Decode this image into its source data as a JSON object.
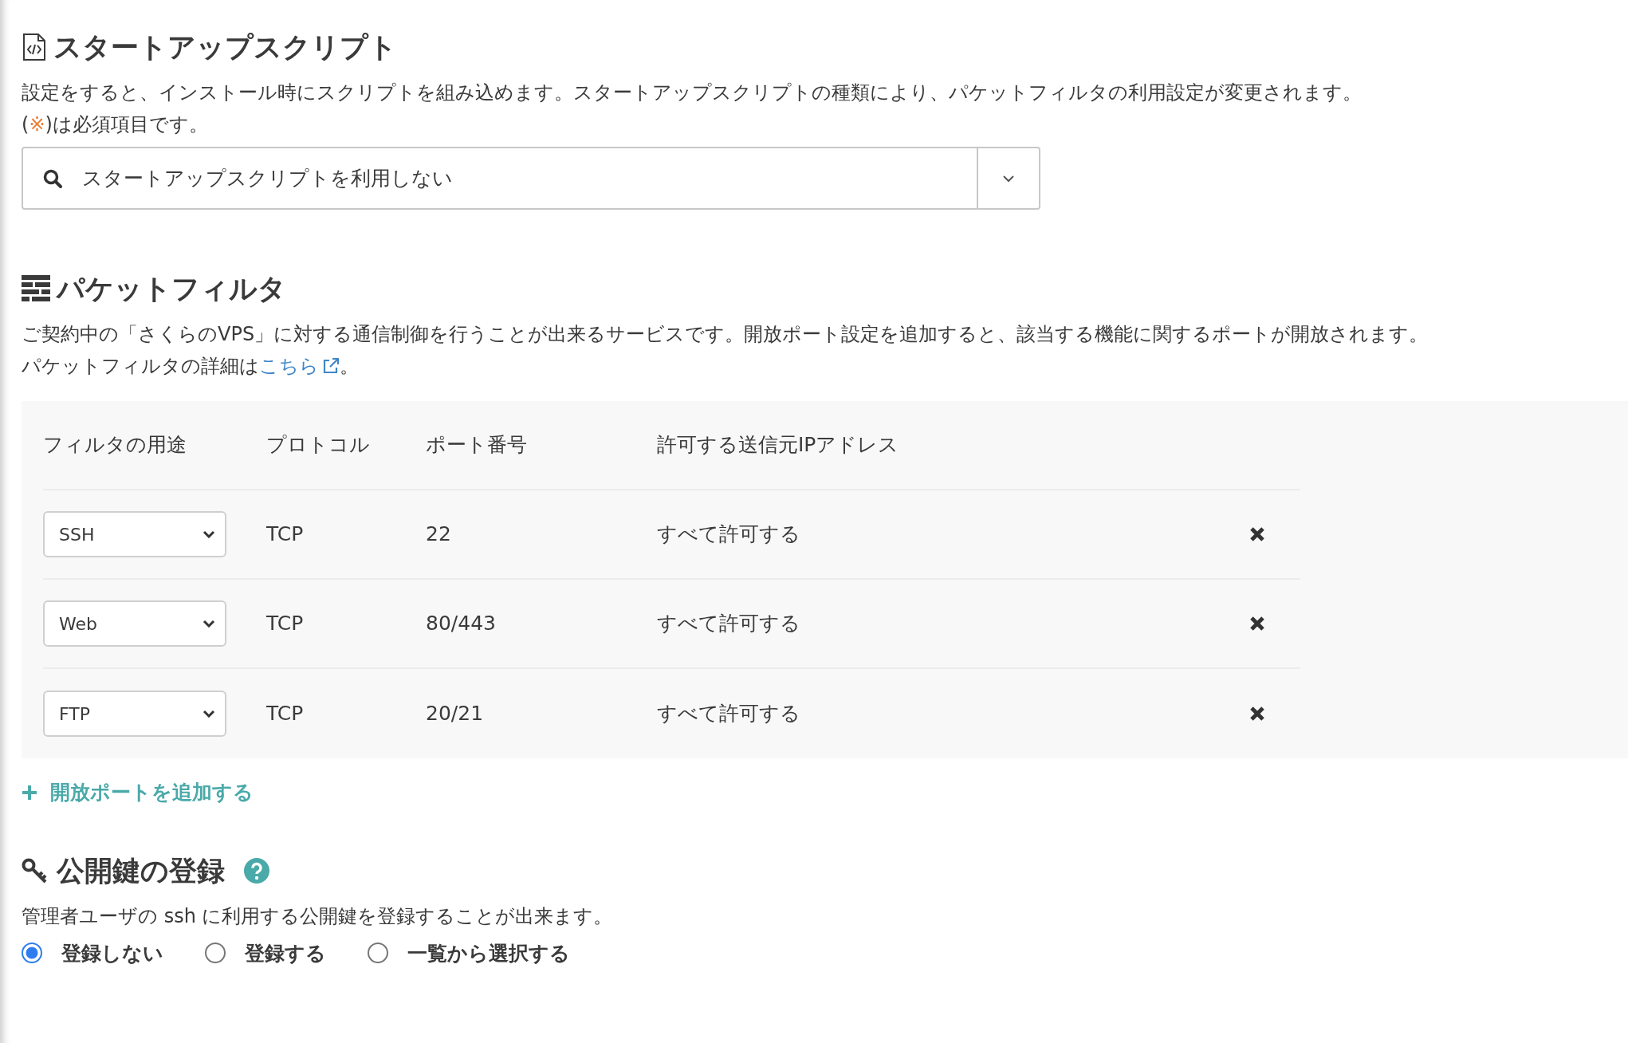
{
  "startup_script": {
    "title": "スタートアップスクリプト",
    "description": "設定をすると、インストール時にスクリプトを組み込めます。スタートアップスクリプトの種類により、パケットフィルタの利用設定が変更されます。",
    "required_note_prefix": "(",
    "required_mark": "※",
    "required_note_suffix": ")は必須項目です。",
    "select_value": "スタートアップスクリプトを利用しない"
  },
  "packet_filter": {
    "title": "パケットフィルタ",
    "description": "ご契約中の「さくらのVPS」に対する通信制御を行うことが出来るサービスです。開放ポート設定を追加すると、該当する機能に関するポートが開放されます。",
    "detail_prefix": "パケットフィルタの詳細は",
    "detail_link": "こちら",
    "detail_suffix": "。",
    "columns": [
      "フィルタの用途",
      "プロトコル",
      "ポート番号",
      "許可する送信元IPアドレス"
    ],
    "rows": [
      {
        "use": "SSH",
        "protocol": "TCP",
        "port": "22",
        "source": "すべて許可する"
      },
      {
        "use": "Web",
        "protocol": "TCP",
        "port": "80/443",
        "source": "すべて許可する"
      },
      {
        "use": "FTP",
        "protocol": "TCP",
        "port": "20/21",
        "source": "すべて許可する"
      }
    ],
    "add_link": "開放ポートを追加する"
  },
  "public_key": {
    "title": "公開鍵の登録",
    "description": "管理者ユーザの ssh に利用する公開鍵を登録することが出来ます。",
    "options": [
      {
        "label": "登録しない",
        "selected": true
      },
      {
        "label": "登録する",
        "selected": false
      },
      {
        "label": "一覧から選択する",
        "selected": false
      }
    ]
  }
}
